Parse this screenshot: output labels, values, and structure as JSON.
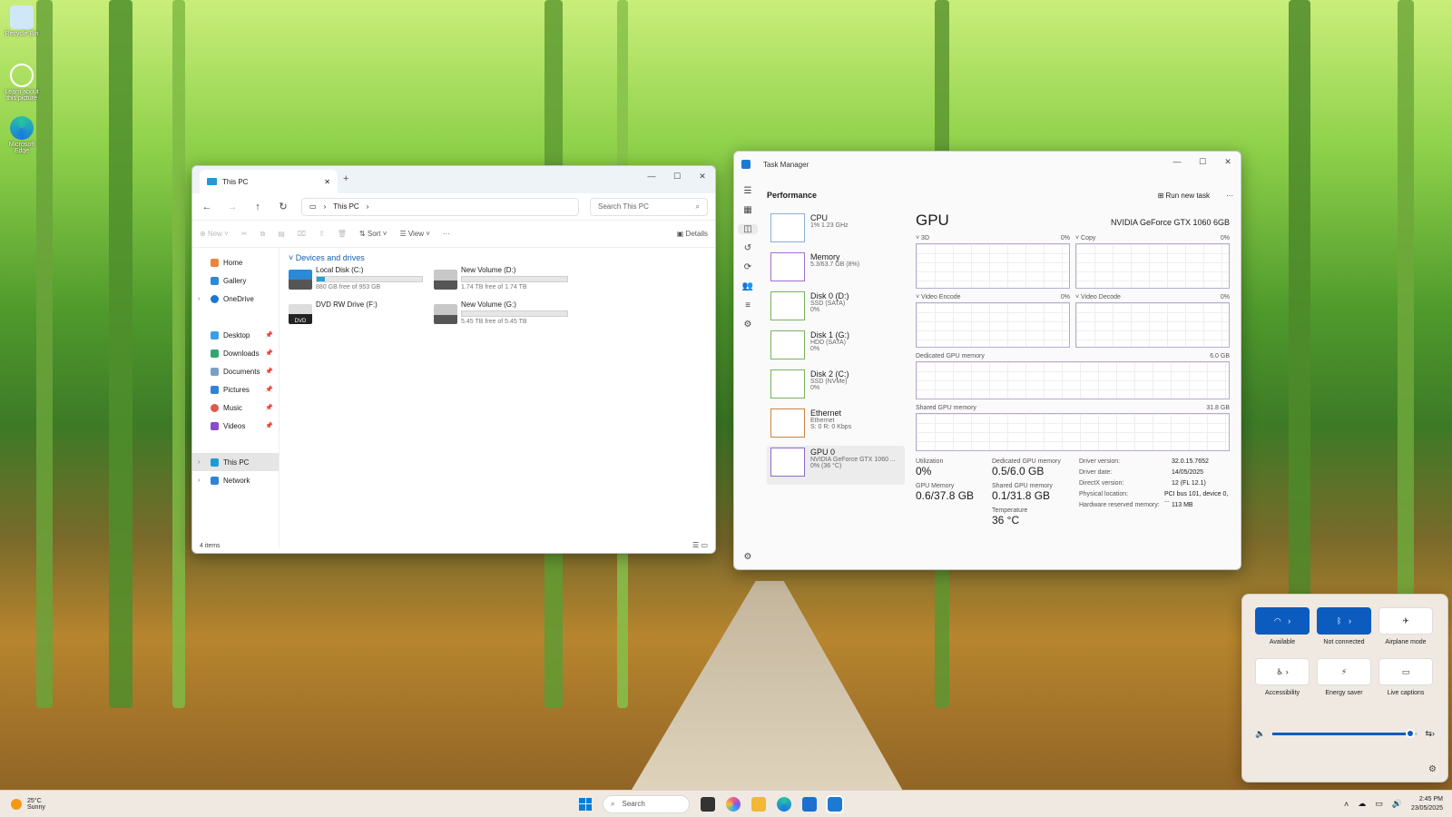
{
  "desktop": {
    "icons": [
      {
        "label": "Recycle Bin"
      },
      {
        "label": "Learn about this picture"
      },
      {
        "label": "Microsoft Edge"
      }
    ]
  },
  "explorer": {
    "tab_title": "This PC",
    "address": "This PC",
    "search_placeholder": "Search This PC",
    "toolbar": {
      "new": "New",
      "sort": "Sort",
      "view": "View",
      "more": "···",
      "details": "Details"
    },
    "nav": {
      "home": "Home",
      "gallery": "Gallery",
      "onedrive": "OneDrive",
      "desktop": "Desktop",
      "downloads": "Downloads",
      "documents": "Documents",
      "pictures": "Pictures",
      "music": "Music",
      "videos": "Videos",
      "thispc": "This PC",
      "network": "Network"
    },
    "section": "Devices and drives",
    "drives": [
      {
        "name": "Local Disk (C:)",
        "free": "880 GB free of 953 GB",
        "used": 0.08
      },
      {
        "name": "New Volume (D:)",
        "free": "1.74 TB free of 1.74 TB",
        "used": 0.0
      },
      {
        "name": "DVD RW Drive (F:)",
        "free": "",
        "used": null
      },
      {
        "name": "New Volume (G:)",
        "free": "5.45 TB free of 5.45 TB",
        "used": 0.0
      }
    ],
    "dvd_label": "DVD",
    "status": "4 items"
  },
  "taskmgr": {
    "title": "Task Manager",
    "page": "Performance",
    "run_new_task": "Run new task",
    "items": [
      {
        "name": "CPU",
        "sub1": "1% 1.23 GHz",
        "sub2": ""
      },
      {
        "name": "Memory",
        "sub1": "5.3/63.7 GB (8%)",
        "sub2": ""
      },
      {
        "name": "Disk 0 (D:)",
        "sub1": "SSD (SATA)",
        "sub2": "0%"
      },
      {
        "name": "Disk 1 (G:)",
        "sub1": "HDD (SATA)",
        "sub2": "0%"
      },
      {
        "name": "Disk 2 (C:)",
        "sub1": "SSD (NVMe)",
        "sub2": "0%"
      },
      {
        "name": "Ethernet",
        "sub1": "Ethernet",
        "sub2": "S: 0 R: 0 Kbps"
      },
      {
        "name": "GPU 0",
        "sub1": "NVIDIA GeForce GTX 1060 ...",
        "sub2": "0% (36 °C)"
      }
    ],
    "gpu": {
      "heading": "GPU",
      "model": "NVIDIA GeForce GTX 1060 6GB",
      "graphs": [
        {
          "label": "3D",
          "pct": "0%"
        },
        {
          "label": "Copy",
          "pct": "0%"
        },
        {
          "label": "Video Encode",
          "pct": "0%"
        },
        {
          "label": "Video Decode",
          "pct": "0%"
        }
      ],
      "dedicated_label": "Dedicated GPU memory",
      "dedicated_max": "6.0 GB",
      "shared_label": "Shared GPU memory",
      "shared_max": "31.8 GB",
      "stats": {
        "utilization_label": "Utilization",
        "utilization": "0%",
        "dedicated_label": "Dedicated GPU memory",
        "dedicated": "0.5/6.0 GB",
        "gpu_memory_label": "GPU Memory",
        "gpu_memory": "0.6/37.8 GB",
        "shared_label": "Shared GPU memory",
        "shared": "0.1/31.8 GB",
        "temperature_label": "Temperature",
        "temperature": "36 °C"
      },
      "info": [
        {
          "k": "Driver version:",
          "v": "32.0.15.7652"
        },
        {
          "k": "Driver date:",
          "v": "14/05/2025"
        },
        {
          "k": "DirectX version:",
          "v": "12 (FL 12.1)"
        },
        {
          "k": "Physical location:",
          "v": "PCI bus 101, device 0, ..."
        },
        {
          "k": "Hardware reserved memory:",
          "v": "113 MB"
        }
      ]
    }
  },
  "quick_settings": {
    "tiles": [
      {
        "label": "Available",
        "icon": "wifi-icon",
        "on": true
      },
      {
        "label": "Not connected",
        "icon": "bluetooth-icon",
        "on": true
      },
      {
        "label": "Airplane mode",
        "icon": "airplane-icon",
        "on": false
      },
      {
        "label": "Accessibility",
        "icon": "accessibility-icon",
        "on": false
      },
      {
        "label": "Energy saver",
        "icon": "energy-saver-icon",
        "on": false
      },
      {
        "label": "Live captions",
        "icon": "captions-icon",
        "on": false
      }
    ],
    "volume": 0.95
  },
  "taskbar": {
    "weather_temp": "25°C",
    "weather_desc": "Sunny",
    "search": "Search",
    "time": "2:45 PM",
    "date": "23/05/2025"
  },
  "colors": {
    "accent": "#0c5cbf",
    "explorer_accent": "#0f5fb3"
  }
}
